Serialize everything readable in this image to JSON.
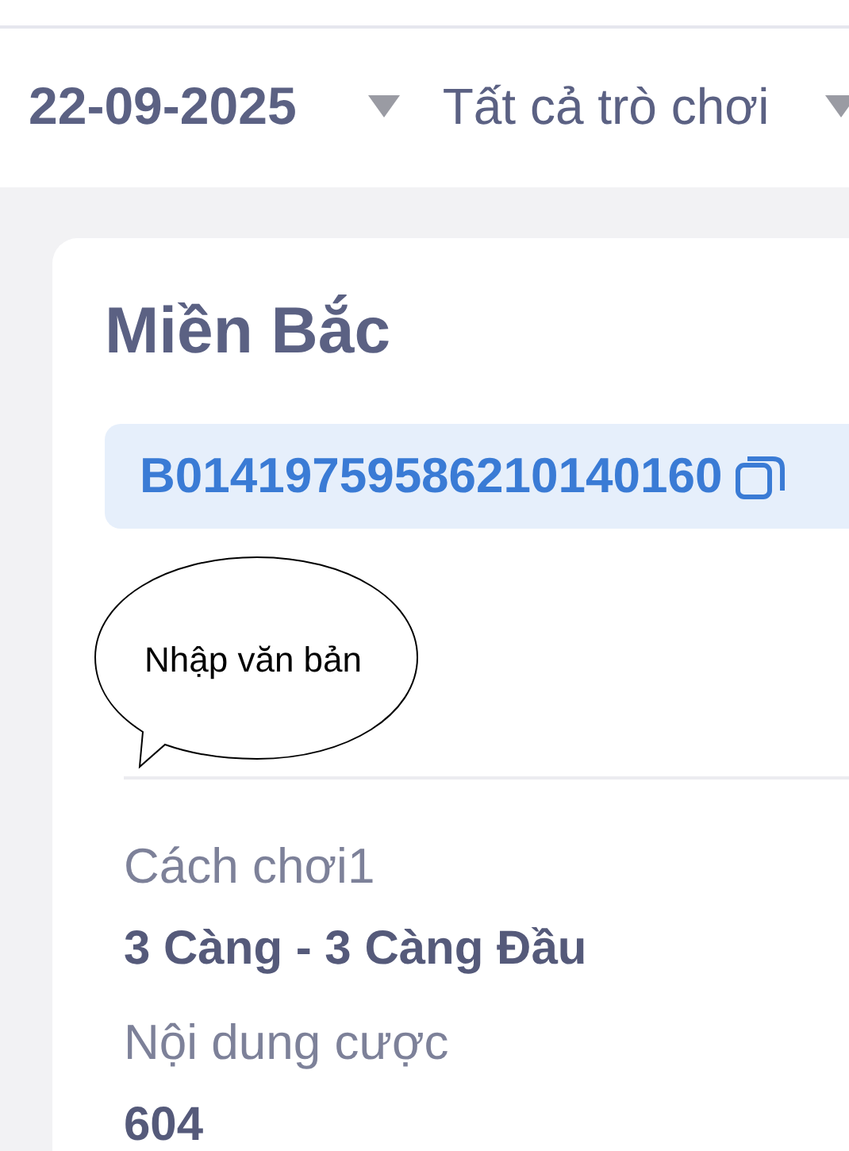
{
  "filters": [
    {
      "label": "22-09-2025",
      "kind": "date"
    },
    {
      "label": "Tất cả trò chơi",
      "kind": "game"
    }
  ],
  "card": {
    "title": "Miền Bắc",
    "ticket_code": "B01419759586210140160",
    "fields": [
      {
        "label": "Cách chơi1",
        "value": "3 Càng - 3 Càng Đầu"
      },
      {
        "label": "Nội dung cược",
        "value": "604"
      }
    ]
  },
  "speech_bubble": {
    "text": "Nhập văn bản"
  }
}
